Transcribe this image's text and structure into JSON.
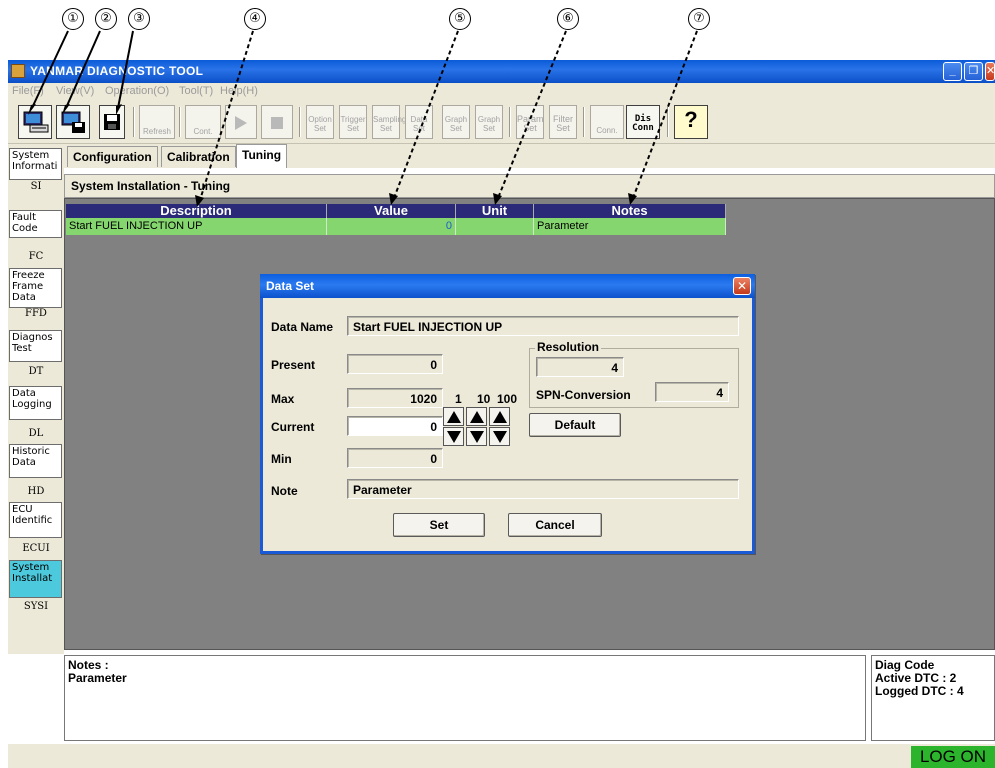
{
  "callouts": [
    "①",
    "②",
    "③",
    "④",
    "⑤",
    "⑥",
    "⑦"
  ],
  "window": {
    "title": "YANMAR DIAGNOSTIC TOOL",
    "minimize": "_",
    "restore": "❐",
    "close": "✕"
  },
  "menu": [
    "File(F)",
    "View(V)",
    "Operation(O)",
    "Tool(T)",
    "Help(H)"
  ],
  "toolbar": {
    "refresh": "Refresh",
    "cont": "Cont.",
    "option_set": "Option Set",
    "trigger_set": "Trigger Set",
    "sampling_set": "Sampling Set",
    "data_set": "Data Set",
    "graph_set1": "Graph Set",
    "graph_set2": "Graph Set",
    "param_set": "Param Set",
    "filter_set": "Filter Set",
    "conn": "Conn.",
    "dis_conn": "Dis Conn",
    "help_glyph": "?"
  },
  "sidebar": [
    {
      "label": "System Informati",
      "code": "SI",
      "active": false
    },
    {
      "label": "Fault Code",
      "code": "FC",
      "active": false
    },
    {
      "label": "Freeze Frame Data",
      "code": "FFD",
      "active": false
    },
    {
      "label": "Diagnos Test",
      "code": "DT",
      "active": false
    },
    {
      "label": "Data Logging",
      "code": "DL",
      "active": false
    },
    {
      "label": "Historic Data",
      "code": "HD",
      "active": false
    },
    {
      "label": "ECU Identific",
      "code": "ECUI",
      "active": false
    },
    {
      "label": "System Installat",
      "code": "SYSI",
      "active": true
    }
  ],
  "tabs": [
    "Configuration",
    "Calibration",
    "Tuning"
  ],
  "selected_tab": "Tuning",
  "panel_title": "System Installation - Tuning",
  "grid": {
    "headers": [
      "Description",
      "Value",
      "Unit",
      "Notes"
    ],
    "rows": [
      {
        "description": "Start FUEL INJECTION UP",
        "value": "0",
        "unit": "",
        "notes": "Parameter"
      }
    ]
  },
  "dialog": {
    "title": "Data Set",
    "data_name_label": "Data Name",
    "data_name_value": "Start FUEL INJECTION UP",
    "present_label": "Present",
    "present_value": "0",
    "max_label": "Max",
    "max_value": "1020",
    "current_label": "Current",
    "current_value": "0",
    "min_label": "Min",
    "min_value": "0",
    "step_labels": [
      "1",
      "10",
      "100"
    ],
    "resolution_label": "Resolution",
    "resolution_value": "4",
    "spn_label": "SPN-Conversion",
    "spn_value": "4",
    "default_button": "Default",
    "note_label": "Note",
    "note_value": "Parameter",
    "set_button": "Set",
    "cancel_button": "Cancel"
  },
  "notes_panel": {
    "heading": "Notes :",
    "text": "Parameter"
  },
  "diag_panel": {
    "heading": "Diag Code",
    "active": "Active DTC : 2",
    "logged": "Logged DTC : 4"
  },
  "status": {
    "logon": "LOG ON"
  },
  "colors": {
    "grid_header_bg": "#2a2a78",
    "grid_row_bg": "#85d66f",
    "active_sidebar_bg": "#4cc9dd",
    "logon_bg": "#2cb52c",
    "titlebar_blue": "#0a5bd8"
  }
}
